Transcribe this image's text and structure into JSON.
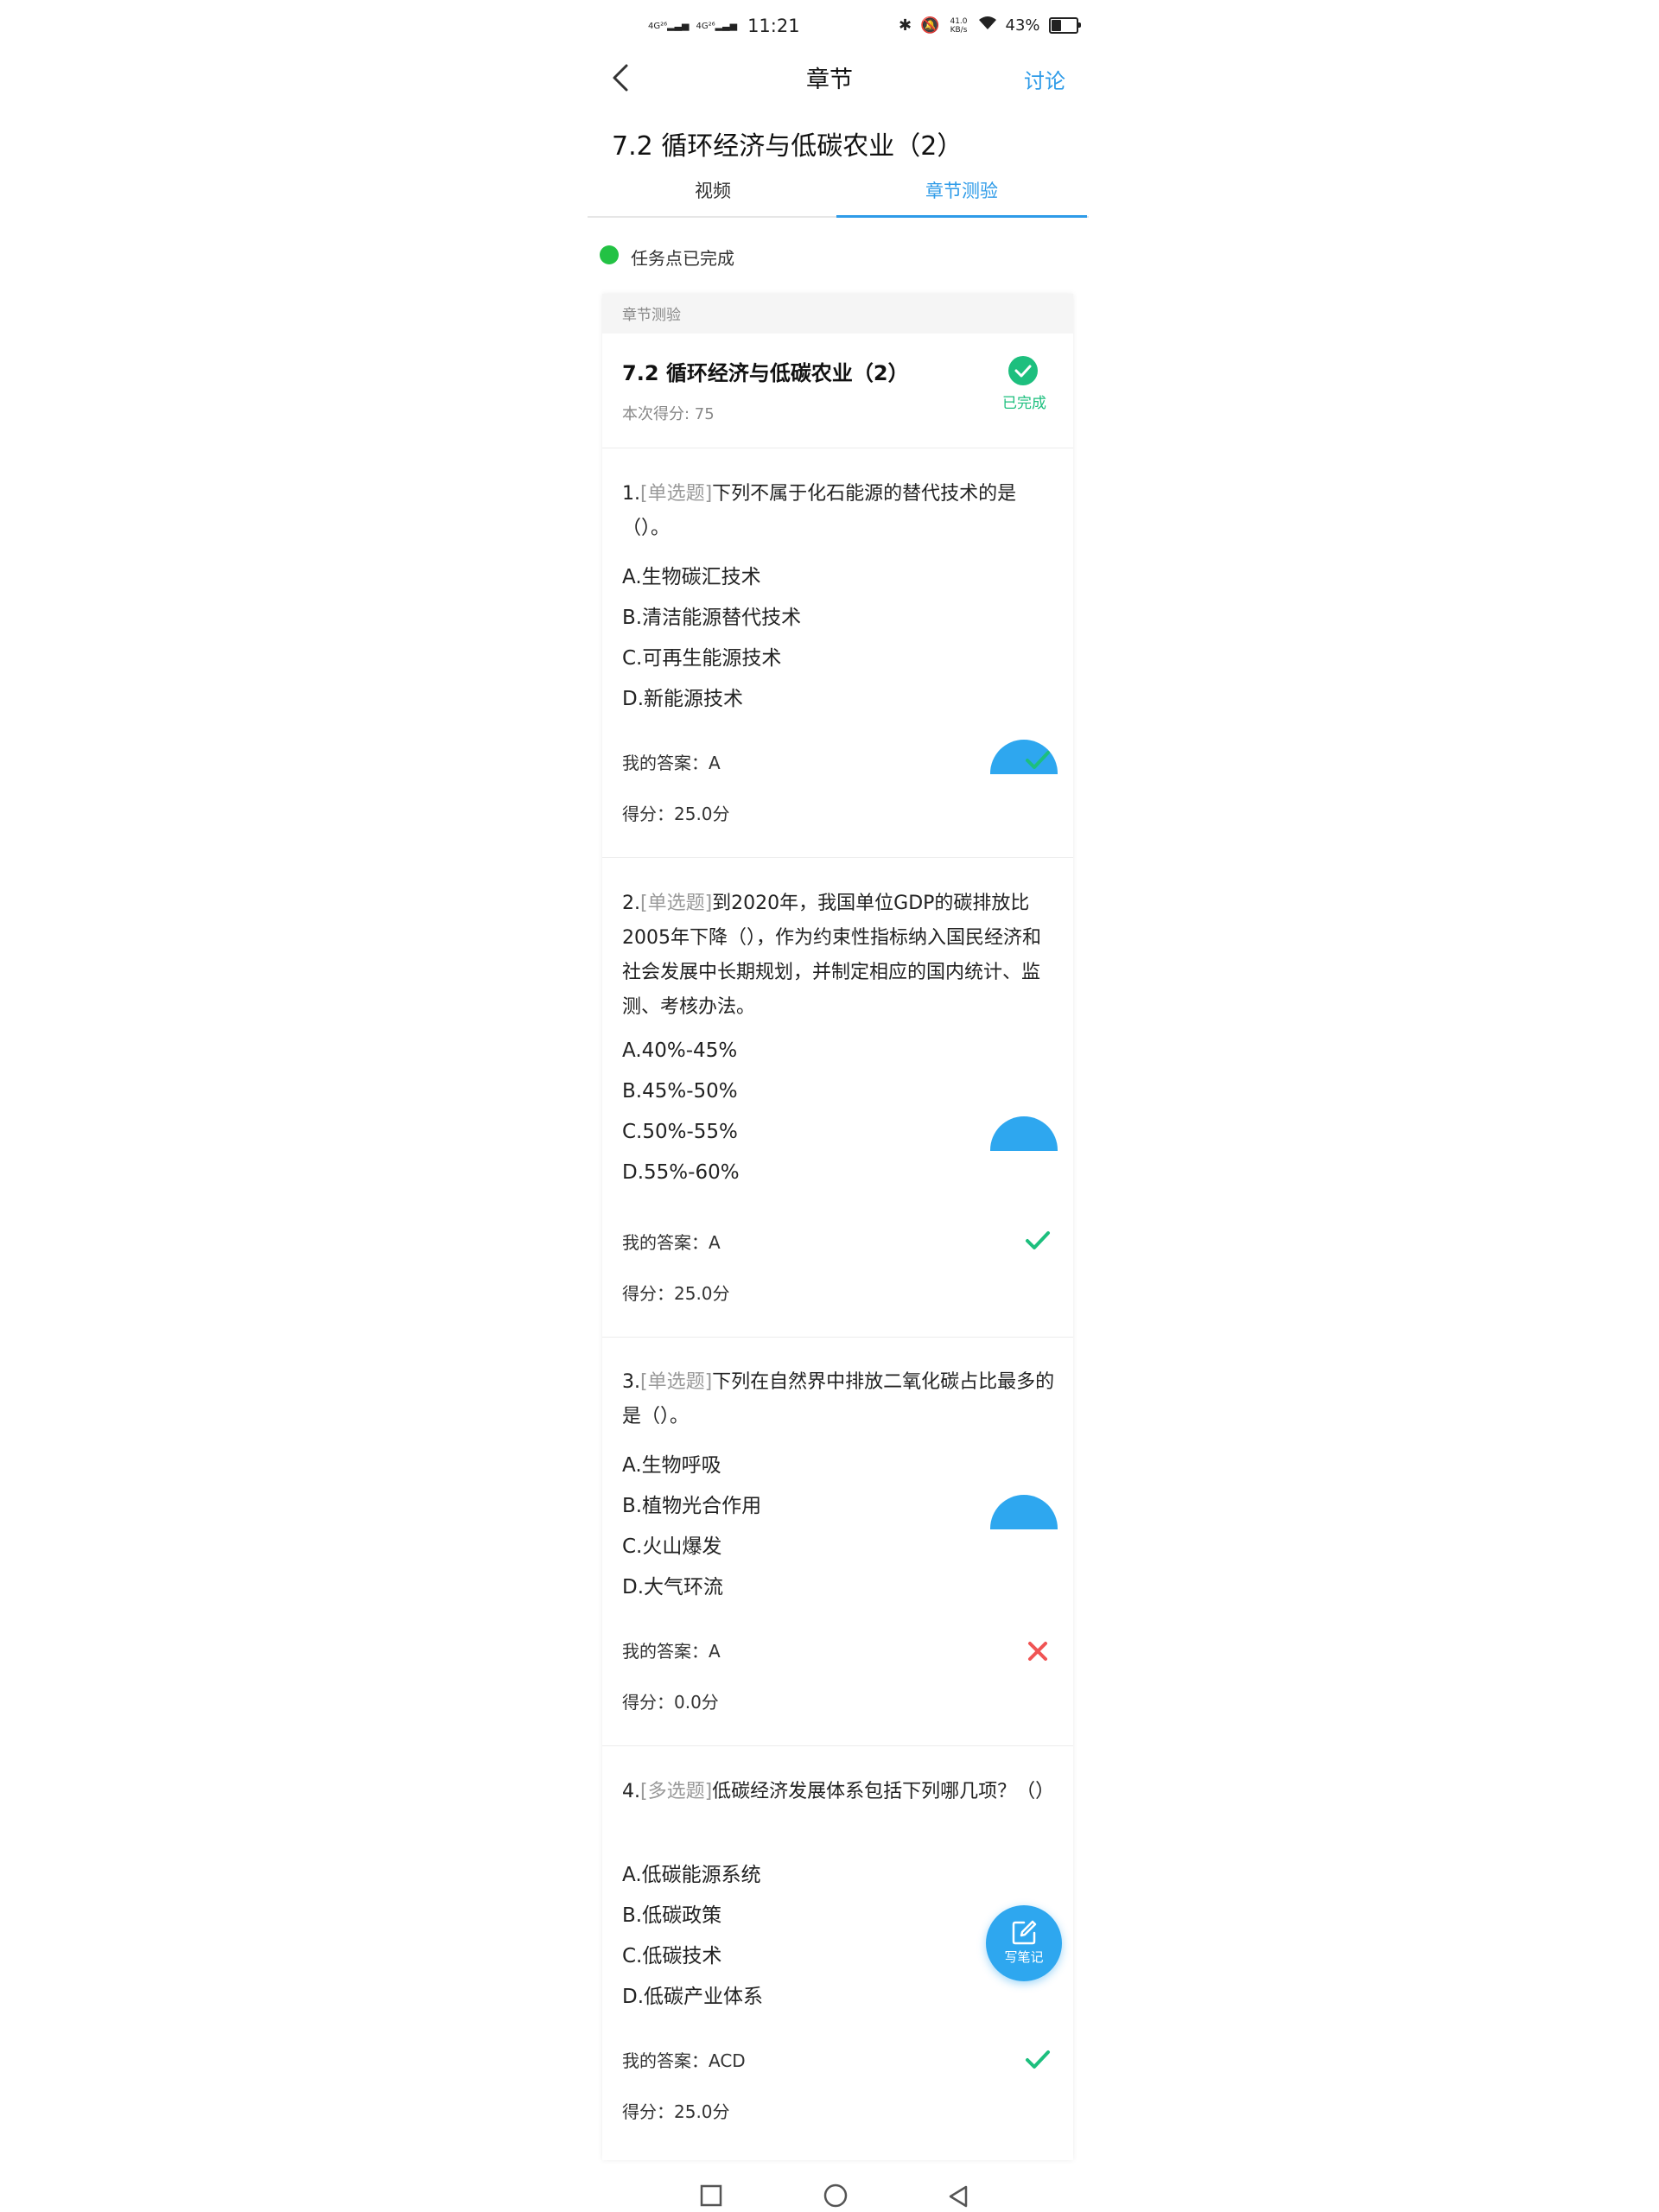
{
  "status_bar": {
    "signal1": "4G²⁶",
    "signal2": "4G²⁶",
    "time": "11:21",
    "speed": "41.0 KB/s",
    "battery": "43%",
    "battery_level": 0.43
  },
  "header": {
    "title": "章节",
    "discuss": "讨论"
  },
  "chapter_title": "7.2  循环经济与低碳农业（2）",
  "tabs": [
    {
      "label": "视频"
    },
    {
      "label": "章节测验"
    }
  ],
  "task_status": "任务点已完成",
  "quiz": {
    "section_label": "章节测验",
    "title": "7.2 循环经济与低碳农业（2）",
    "score_text": "本次得分: 75",
    "status": "已完成"
  },
  "questions": [
    {
      "number": "1.",
      "type": "[单选题]",
      "text": "下列不属于化石能源的替代技术的是（）。",
      "options": [
        "A.生物碳汇技术",
        "B.清洁能源替代技术",
        "C.可再生能源技术",
        "D.新能源技术"
      ],
      "my_answer": "我的答案：A",
      "score": "得分：25.0分",
      "result": "correct"
    },
    {
      "number": "2.",
      "type": "[单选题]",
      "text": "到2020年，我国单位GDP的碳排放比2005年下降（），作为约束性指标纳入国民经济和社会发展中长期规划，并制定相应的国内统计、监测、考核办法。",
      "options": [
        "A.40%-45%",
        "B.45%-50%",
        "C.50%-55%",
        "D.55%-60%"
      ],
      "my_answer": "我的答案：A",
      "score": "得分：25.0分",
      "result": "correct"
    },
    {
      "number": "3.",
      "type": "[单选题]",
      "text": "下列在自然界中排放二氧化碳占比最多的是（）。",
      "options": [
        "A.生物呼吸",
        "B.植物光合作用",
        "C.火山爆发",
        "D.大气环流"
      ],
      "my_answer": "我的答案：A",
      "score": "得分：0.0分",
      "result": "wrong"
    },
    {
      "number": "4.",
      "type": "[多选题]",
      "text": "低碳经济发展体系包括下列哪几项？（）",
      "options": [
        "A.低碳能源系统",
        "B.低碳政策",
        "C.低碳技术",
        "D.低碳产业体系"
      ],
      "my_answer": "我的答案：ACD",
      "score": "得分：25.0分",
      "result": "correct"
    }
  ],
  "note_button": "写笔记",
  "colors": {
    "accent": "#2e9be8",
    "success": "#1dbf7e",
    "error": "#f05454",
    "task_dot": "#23c244"
  }
}
